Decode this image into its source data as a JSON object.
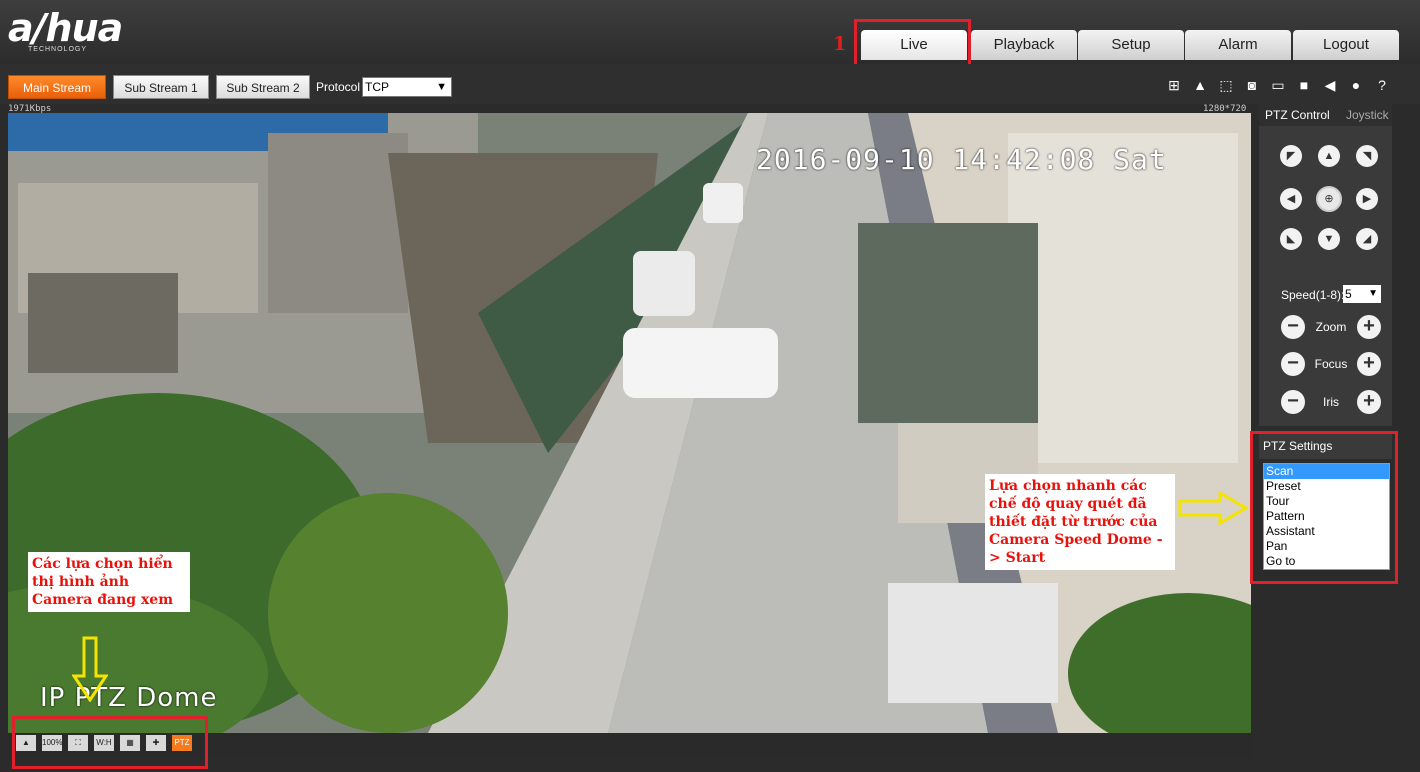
{
  "header": {
    "logo": "a/hua",
    "logo_sub": "TECHNOLOGY",
    "tabs": [
      {
        "label": "Live"
      },
      {
        "label": "Playback"
      },
      {
        "label": "Setup"
      },
      {
        "label": "Alarm"
      },
      {
        "label": "Logout"
      }
    ],
    "annotation_number": "1"
  },
  "toolbar": {
    "streams": [
      "Main Stream",
      "Sub Stream 1",
      "Sub Stream 2"
    ],
    "protocol_label": "Protocol",
    "protocol_value": "TCP",
    "icons": [
      "region-zoom-icon",
      "alarm-icon",
      "ptz-zoom-icon",
      "snapshot-icon",
      "triple-snapshot-icon",
      "record-icon",
      "audio-icon",
      "talk-icon",
      "help-icon"
    ]
  },
  "video": {
    "bitrate": "1971Kbps",
    "resolution": "1280*720",
    "timestamp": "2016-09-10 14:42:08 Sat",
    "camera_name": "IP PTZ Dome",
    "annotation_left": "Các lựa chọn hiển thị hình ảnh Camera đang xem",
    "annotation_right": "Lựa chọn nhanh các chế độ quay quét đã thiết đặt từ trước của Camera Speed Dome -> Start",
    "view_icons": [
      "",
      "100%",
      "",
      "W:H",
      "",
      "",
      "PTZ"
    ]
  },
  "ptz": {
    "tab_control": "PTZ Control",
    "tab_joystick": "Joystick",
    "speed_label": "Speed(1-8):",
    "speed_value": "5",
    "zoom_label": "Zoom",
    "focus_label": "Focus",
    "iris_label": "Iris"
  },
  "ptz_settings": {
    "title": "PTZ Settings",
    "items": [
      "Scan",
      "Preset",
      "Tour",
      "Pattern",
      "Assistant",
      "Pan",
      "Go to"
    ]
  },
  "colors": {
    "accent": "#f47b20",
    "annotation_red": "#e0202a",
    "selected": "#3399ff"
  }
}
